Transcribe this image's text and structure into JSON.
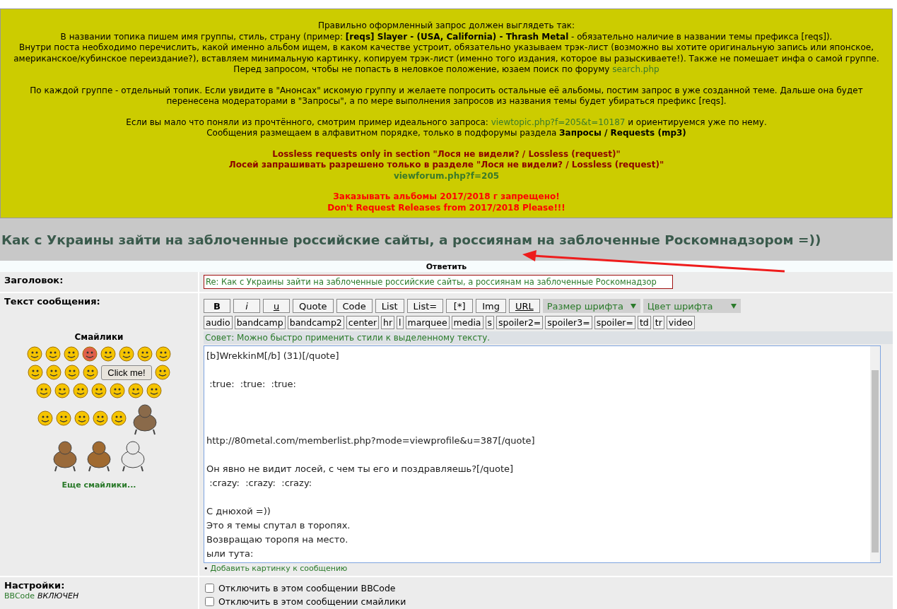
{
  "announcement": {
    "paragraphs": [
      [
        {
          "kind": "text",
          "parts": [
            {
              "kind": "text",
              "text": "Правильно оформленный запрос должен выглядеть так:"
            }
          ]
        },
        {
          "kind": "text",
          "parts": [
            {
              "kind": "text",
              "text": "В названии топика пишем имя группы, стиль, страну (пример: **[reqs] Slayer - (USA, California) - Thrash Metal** - обязательно наличие в названии темы префикса [reqs])."
            }
          ]
        },
        {
          "kind": "text",
          "parts": [
            {
              "kind": "text",
              "text": "Внутри поста необходимо перечислить, какой именно альбом ищем, в каком качестве устроит, обязательно указываем трэк-лист (возможно вы хотите оригинальную запись или японское, американское/кубинское переиздание?), вставляем минимальную картинку, копируем трэк-лист (именно того издания, которое вы разыскиваете!). Также не помешает инфа о самой группе."
            }
          ]
        },
        {
          "kind": "text",
          "parts": [
            {
              "kind": "text",
              "text": "Перед запросом, чтобы не попасть в неловкое положение, юзаем поиск по форуму "
            },
            {
              "kind": "link",
              "text": "search.php"
            }
          ]
        }
      ],
      [
        {
          "kind": "text",
          "parts": [
            {
              "kind": "text",
              "text": "По каждой группе - отдельный топик. Если увидите в \"Анонсах\" искомую группу и желаете попросить остальные её альбомы, постим запрос в уже созданной теме. Дальше она будет перенесена модераторами в \"Запросы\", а по мере выполнения запросов из названия темы будет убираться префикс [reqs]."
            }
          ]
        }
      ],
      [
        {
          "kind": "text",
          "parts": [
            {
              "kind": "text",
              "text": "Если вы мало что поняли из прочтённого, смотрим пример идеального запроса: "
            },
            {
              "kind": "link",
              "text": "viewtopic.php?f=205&t=10187"
            },
            {
              "kind": "text",
              "text": " и ориентируемся уже по нему."
            }
          ]
        },
        {
          "kind": "text",
          "parts": [
            {
              "kind": "text",
              "text": "Сообщения размещаем в алфавитном порядке, только в подфорумы раздела **Запросы / Requests (mp3)**"
            }
          ]
        }
      ],
      [
        {
          "kind": "warning",
          "parts": [
            {
              "kind": "text",
              "text": "Lossless requests only in section \"Лося не видели? / Lossless (request)\""
            }
          ]
        },
        {
          "kind": "warning",
          "parts": [
            {
              "kind": "text",
              "text": "Лосей запрашивать разрешено только в разделе \"Лося не видели? / Lossless (request)\""
            }
          ]
        },
        {
          "kind": "warning",
          "parts": [
            {
              "kind": "link",
              "text": "viewforum.php?f=205"
            }
          ]
        }
      ],
      [
        {
          "kind": "alert",
          "parts": [
            {
              "kind": "text",
              "text": "Заказывать альбомы 2017/2018 г запрещено!"
            }
          ]
        },
        {
          "kind": "alert",
          "parts": [
            {
              "kind": "text",
              "text": "Don't Request Releases from 2017/2018 Please!!!"
            }
          ]
        }
      ]
    ]
  },
  "topic_title": "Как с Украины зайти на заблоченные российские сайты, а россиянам на заблоченные Роскомнадзором =))",
  "form": {
    "heading": "Ответить",
    "subject": {
      "label": "Заголовок:",
      "value": "Re: Как с Украины зайти на заблоченные российские сайты, а россиянам на заблоченные Роскомнадзор"
    },
    "message": {
      "label": "Текст сообщения:",
      "format_buttons": [
        {
          "label": "B",
          "kind": "bold"
        },
        {
          "label": "i",
          "kind": "italic"
        },
        {
          "label": "u",
          "kind": "underline"
        },
        {
          "label": "Quote",
          "kind": "plain"
        },
        {
          "label": "Code",
          "kind": "plain"
        },
        {
          "label": "List",
          "kind": "plain"
        },
        {
          "label": "List=",
          "kind": "plain"
        },
        {
          "label": "[*]",
          "kind": "plain"
        },
        {
          "label": "Img",
          "kind": "plain"
        },
        {
          "label": "URL",
          "kind": "underline"
        }
      ],
      "dropdowns": [
        {
          "label": "Размер шрифта"
        },
        {
          "label": "Цвет шрифта"
        }
      ],
      "tag_buttons": [
        "audio",
        "bandcamp",
        "bandcamp2",
        "center",
        "hr",
        "l",
        "marquee",
        "media",
        "s",
        "spoiler2=",
        "spoiler3=",
        "spoiler=",
        "td",
        "tr",
        "video"
      ],
      "hint": "Совет: Можно быстро применить стили к выделенному тексту.",
      "text": "[b]WrekkinM[/b] (31)[/quote]\n\n :true:  :true:  :true:\n\n\n\nhttp://80metal.com/memberlist.php?mode=viewprofile&u=387[/quote]\n\nОн явно не видит лосей, с чем ты его и поздравляешь?[/quote]\n :crazy:  :crazy:  :crazy:\n\nС днюхой =))\nЭто я темы спутал в торопях.\nВозвращаю торопя на место.\nыли тута:",
      "add_image_bullet": "•",
      "add_image": "Добавить картинку к сообщению"
    },
    "smilies": {
      "title": "Смайлики",
      "click_button": "Click me!",
      "more": "Еще смайлики..."
    },
    "settings": {
      "label": "Настройки:",
      "bbcode_link": "BBCode",
      "bbcode_state": "ВКЛЮЧЕН",
      "options": [
        {
          "label": "Отключить в этом сообщении BBCode",
          "checked": false
        },
        {
          "label": "Отключить в этом сообщении смайлики",
          "checked": false
        }
      ]
    }
  }
}
